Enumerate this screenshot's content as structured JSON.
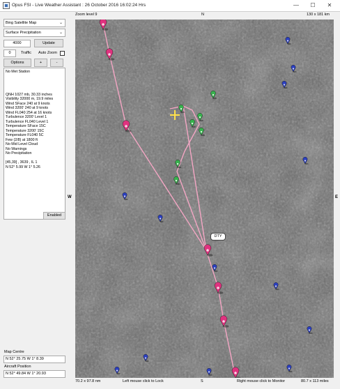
{
  "window": {
    "title": "Opus FSI - Live Weather Assistant : 26 October 2016  16:02:24 Hrs",
    "minimize": "—",
    "maximize": "☐",
    "close": "✕"
  },
  "controls": {
    "map_type": "Bing Satellite Map",
    "layer": "Surface Precipitation",
    "altitude": "4000",
    "update_label": "Update",
    "traffic_count": "0",
    "traffic_label": "Traffic",
    "auto_zoom_label": "Auto Zoom",
    "auto_zoom_checked": false,
    "options_label": "Options",
    "zoom_in_label": "+",
    "zoom_out_label": "-",
    "enabled_label": "Enabled"
  },
  "info": {
    "lines": [
      "No Met Station",
      "",
      "",
      "",
      "",
      "QNH 1027 mb, 30.33 inches",
      "Visibility 32000 m, 19.9 miles",
      "Wind SFace 240 at 9 knots",
      "Wind 3200' 240 at 9 knots",
      "Wind FL040 254 at 16 knots",
      "Turbulence 3200' Level 1",
      "Turbulence FL040 Level 1",
      "Temperature SFace 15C",
      "Temperature 3200' 15C",
      "Temperature FL040 5C",
      "Few (2/8) at 1800 ft",
      "No Mid Level Cloud",
      "No Warnings",
      "No Precipitation",
      "",
      "[45,39] , 3639 , IL 1",
      "N 52° 5.99  W 1° 5.26"
    ]
  },
  "map_centre": {
    "label": "Map Centre",
    "value": "N 52° 25.75  W 1° 8.39"
  },
  "aircraft_position": {
    "label": "Aircraft Position",
    "value": "N 52° 49.84  W 1° 20.93"
  },
  "map": {
    "zoom_label": "Zoom level 9",
    "size_label": "130 x 181 km",
    "north": "N",
    "south": "S",
    "west": "W",
    "east": "E",
    "bottom_left": "70.2 x 97.8 nm",
    "left_click_hint": "Left mouse click to Lock",
    "right_click_hint": "Right mouse click to Monitor",
    "bottom_right": "80.7 x 113 miles",
    "waypoint_tag": "DTY",
    "colors": {
      "route": "#f4a6c4",
      "pink_marker": "#e0327f",
      "green_marker": "#37b24d",
      "blue_marker": "#2b3fbf",
      "aircraft": "#ffe14a"
    }
  }
}
